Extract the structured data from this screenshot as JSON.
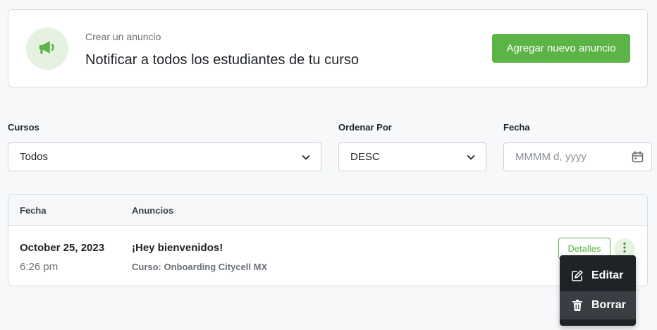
{
  "announce": {
    "subtitle": "Crear un anuncio",
    "title": "Notificar a todos los estudiantes de tu curso",
    "button_label": "Agregar nuevo anuncio",
    "icon": "megaphone-icon"
  },
  "filters": {
    "courses": {
      "label": "Cursos",
      "value": "Todos"
    },
    "order": {
      "label": "Ordenar Por",
      "value": "DESC"
    },
    "date": {
      "label": "Fecha",
      "placeholder": "MMMM d, yyyy"
    }
  },
  "table": {
    "columns": [
      "Fecha",
      "Anuncios"
    ],
    "rows": [
      {
        "date": "October 25, 2023",
        "time": "6:26 pm",
        "title": "¡Hey bienvenidos!",
        "course": "Curso: Onboarding Citycell MX",
        "details_label": "Detalles"
      }
    ]
  },
  "menu": {
    "items": [
      {
        "label": "Editar",
        "icon": "edit-icon"
      },
      {
        "label": "Borrar",
        "icon": "trash-icon"
      }
    ]
  },
  "colors": {
    "accent": "#5cb346",
    "accent_light": "#e6f2e1",
    "menu_bg": "#1f2226",
    "menu_active": "#3a3e44"
  }
}
